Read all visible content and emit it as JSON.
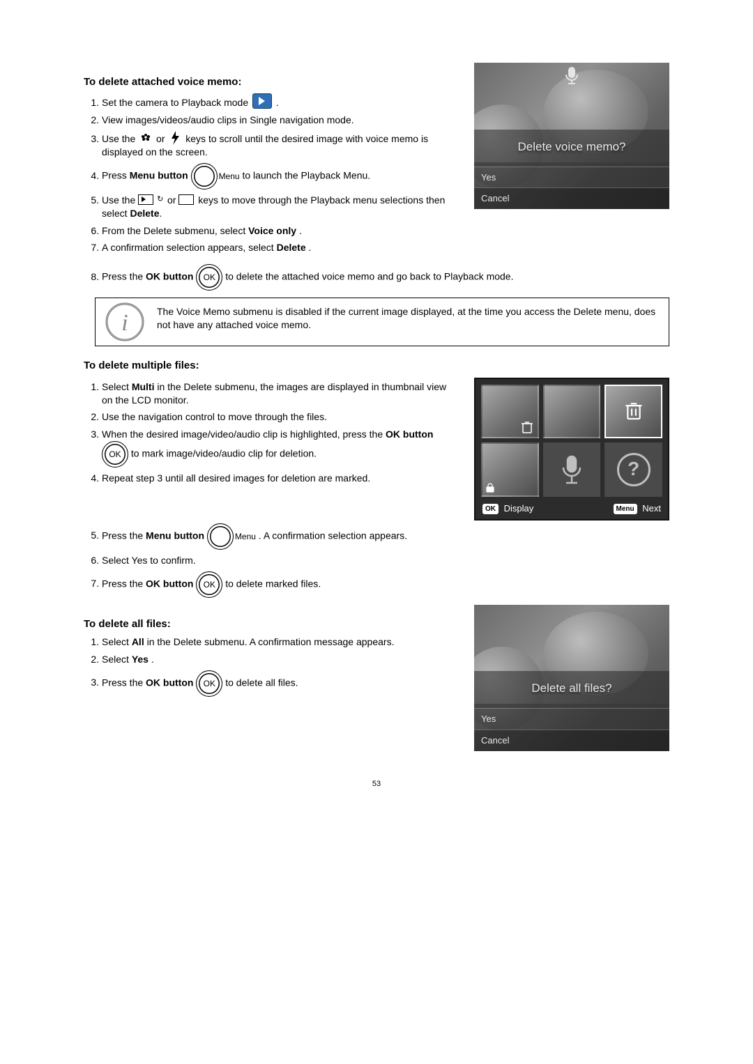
{
  "page_number": "53",
  "section1": {
    "heading": "To delete attached voice memo:",
    "steps": {
      "s1a": "Set the camera to Playback mode ",
      "s1b": ".",
      "s2": "View images/videos/audio clips in Single navigation mode.",
      "s3a": "Use the ",
      "s3b": " or ",
      "s3c": " keys to scroll until the desired image with voice memo is displayed on the screen.",
      "s4a": "Press ",
      "s4b": "Menu button",
      "s4c": " to launch the Playback Menu.",
      "s4_menu_label": "Menu",
      "s5a": "Use the ",
      "s5b": " or ",
      "s5c": " keys to move through the Playback menu selections then select ",
      "s5d": "Delete",
      "s5e": ".",
      "s6a": "From the Delete submenu, select ",
      "s6b": "Voice only",
      "s6c": ".",
      "s7a": "A confirmation selection appears, select ",
      "s7b": "Delete",
      "s7c": ".",
      "s8a": "Press the ",
      "s8b": "OK button",
      "s8c": " to delete the attached voice memo and go back to Playback mode."
    },
    "note": "The Voice Memo submenu is disabled if the current image displayed, at the time you access the Delete menu, does not have any attached voice memo.",
    "dialog": {
      "title": "Delete voice memo?",
      "opt1": "Yes",
      "opt2": "Cancel"
    }
  },
  "section2": {
    "heading": "To delete multiple files:",
    "steps": {
      "s1a": "Select ",
      "s1b": "Multi",
      "s1c": " in the Delete submenu, the images are displayed in thumbnail view on the LCD monitor.",
      "s2": "Use the navigation control to move through the files.",
      "s3a": "When the desired image/video/audio clip is highlighted, press the ",
      "s3b": "OK button",
      "s3c": " to mark image/video/audio clip for deletion.",
      "s4": "Repeat step 3 until all desired images for deletion are marked.",
      "s5a": "Press the ",
      "s5b": "Menu button",
      "s5c": ". A confirmation selection appears.",
      "s5_menu_label": "Menu",
      "s6": "Select Yes to confirm.",
      "s7a": "Press the ",
      "s7b": "OK button",
      "s7c": " to delete marked files."
    },
    "bottombar": {
      "ok_pill": "OK",
      "display": "Display",
      "menu_pill": "Menu",
      "next": "Next"
    }
  },
  "section3": {
    "heading": "To delete all files:",
    "steps": {
      "s1a": "Select ",
      "s1b": "All",
      "s1c": " in the Delete submenu. A confirmation message appears.",
      "s2a": "Select ",
      "s2b": "Yes",
      "s2c": ".",
      "s3a": "Press the ",
      "s3b": "OK button",
      "s3c": " to delete all files."
    },
    "dialog": {
      "title": "Delete all files?",
      "opt1": "Yes",
      "opt2": "Cancel"
    }
  }
}
